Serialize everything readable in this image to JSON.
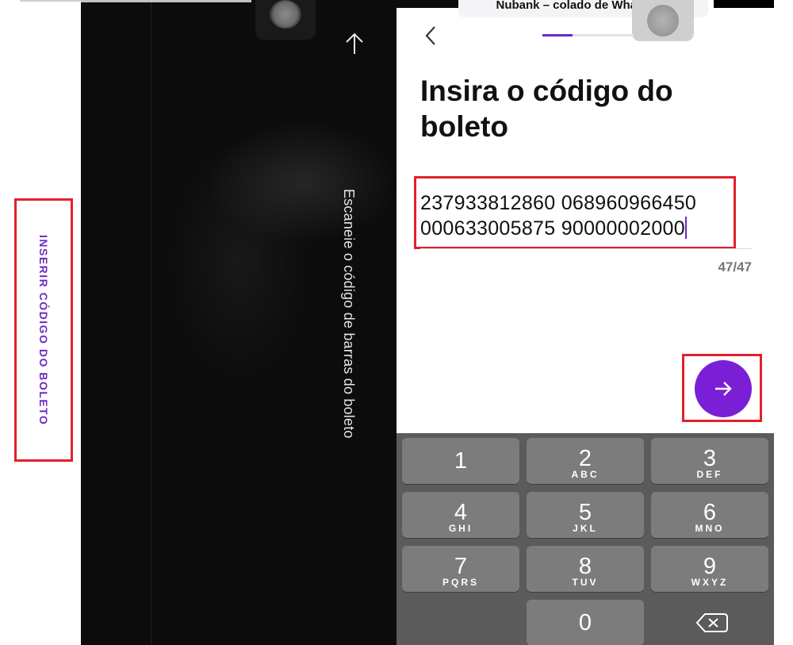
{
  "left_panel": {
    "insert_code_label": "INSERIR CÓDIGO DO BOLETO",
    "scan_instruction": "Escaneie o código de barras do boleto"
  },
  "banner": {
    "text": "Nubank – colado de WhatsApp"
  },
  "form": {
    "progress_fraction": 0.33,
    "title": "Insira o código do boleto",
    "code_line1": "237933812860 068960966450",
    "code_line2": "000633005875 90000002000",
    "counter": "47/47"
  },
  "keypad": {
    "keys": [
      {
        "num": "1",
        "letters": ""
      },
      {
        "num": "2",
        "letters": "ABC"
      },
      {
        "num": "3",
        "letters": "DEF"
      },
      {
        "num": "4",
        "letters": "GHI"
      },
      {
        "num": "5",
        "letters": "JKL"
      },
      {
        "num": "6",
        "letters": "MNO"
      },
      {
        "num": "7",
        "letters": "PQRS"
      },
      {
        "num": "8",
        "letters": "TUV"
      },
      {
        "num": "9",
        "letters": "WXYZ"
      },
      {
        "num": "0",
        "letters": ""
      }
    ]
  },
  "colors": {
    "accent_purple": "#7a1fd6",
    "highlight_red": "#e3202b"
  }
}
